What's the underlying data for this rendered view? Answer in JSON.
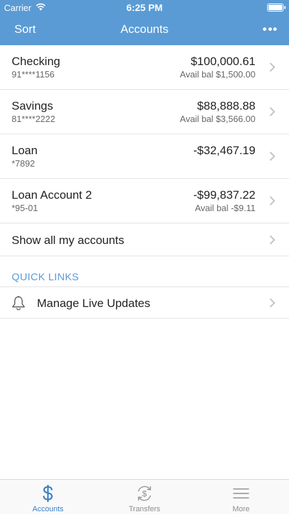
{
  "status_bar": {
    "carrier": "Carrier",
    "time": "6:25 PM"
  },
  "nav": {
    "sort_label": "Sort",
    "title": "Accounts",
    "more_icon": "ellipsis-icon"
  },
  "accounts": [
    {
      "name": "Checking",
      "number": "91****1156",
      "balance": "$100,000.61",
      "avail": "Avail bal $1,500.00"
    },
    {
      "name": "Savings",
      "number": "81****2222",
      "balance": "$88,888.88",
      "avail": "Avail bal $3,566.00"
    },
    {
      "name": "Loan",
      "number": "*7892",
      "balance": "-$32,467.19",
      "avail": ""
    },
    {
      "name": "Loan Account 2",
      "number": "*95-01",
      "balance": "-$99,837.22",
      "avail": "Avail bal -$9.11"
    }
  ],
  "show_all_label": "Show all my accounts",
  "quick_links": {
    "heading": "QUICK LINKS",
    "items": [
      {
        "label": "Manage Live Updates",
        "icon": "bell-icon"
      }
    ]
  },
  "tabs": [
    {
      "label": "Accounts",
      "icon": "dollar-icon",
      "active": true
    },
    {
      "label": "Transfers",
      "icon": "transfer-icon",
      "active": false
    },
    {
      "label": "More",
      "icon": "menu-icon",
      "active": false
    }
  ],
  "colors": {
    "accent": "#5b9bd5",
    "active_tab": "#3b7fc4",
    "inactive_tab": "#8e8e93",
    "divider": "#e3e3e3"
  }
}
